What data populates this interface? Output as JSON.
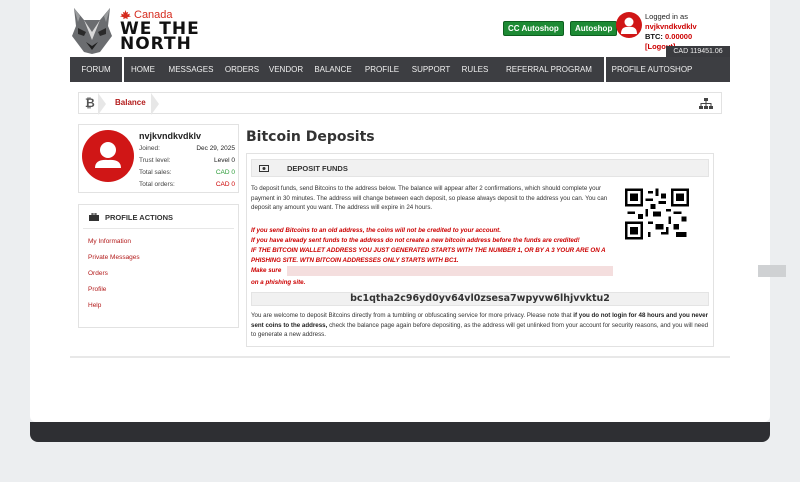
{
  "brand": {
    "country": "Canada",
    "line1": "WE THE",
    "line2": "NORTH"
  },
  "header": {
    "cc_autoshop": "CC Autoshop",
    "autoshop": "Autoshop",
    "logged_in_as": "Logged in as",
    "username": "nvjkvndkvdklv",
    "btc_label": "BTC:",
    "btc_value": "0.00000",
    "logout": "[Logout]",
    "cad_badge": "CAD 119451.06"
  },
  "nav": [
    {
      "label": "FORUM"
    },
    {
      "label": "HOME"
    },
    {
      "label": "MESSAGES"
    },
    {
      "label": "ORDERS"
    },
    {
      "label": "VENDOR"
    },
    {
      "label": "BALANCE"
    },
    {
      "label": "PROFILE"
    },
    {
      "label": "SUPPORT"
    },
    {
      "label": "RULES"
    },
    {
      "label": "REFERRAL PROGRAM"
    },
    {
      "label": "PROFILE AUTOSHOP"
    }
  ],
  "breadcrumb": {
    "current": "Balance"
  },
  "profile": {
    "username": "nvjkvndkvdklv",
    "joined_label": "Joined:",
    "joined": "Dec 29, 2025",
    "trust_label": "Trust level:",
    "trust": "Level 0",
    "sales_label": "Total sales:",
    "sales": "CAD 0",
    "orders_label": "Total orders:",
    "orders": "CAD 0"
  },
  "actions": {
    "title": "PROFILE ACTIONS",
    "links": [
      {
        "label": "My Information"
      },
      {
        "label": "Private Messages"
      },
      {
        "label": "Orders"
      },
      {
        "label": "Profile"
      },
      {
        "label": "Help"
      }
    ]
  },
  "page": {
    "title": "Bitcoin Deposits",
    "panel_title": "DEPOSIT FUNDS",
    "intro": "To deposit funds, send Bitcoins to the address below. The balance will appear after 2 confirmations, which should complete your payment in 30 minutes. The address will change between each deposit, so please always deposit to the address you can. You can deposit any amount you want. The address will expire in 24 hours.",
    "warn1": "If you send Bitcoins to an old address, the coins will not be credited to your account.",
    "warn2": "If you have already sent funds to the address do not create a new bitcoin address before the funds are credited!",
    "warn3": "IF THE BITCOIN WALLET ADDRESS YOU JUST GENERATED STARTS WITH THE NUMBER 1, OR BY A 3 YOUR ARE ON A PHISHING SITE. WTN BITCOIN ADDRESSES ONLY STARTS WITH BC1.",
    "warn4": "Make sure",
    "warn5": "on a phishing site.",
    "address": "bc1qtha2c96yd0yv64vl0zsesa7wpyvw6lhjvvktu2",
    "outro_a": "You are welcome to deposit Bitcoins directly from a tumbling or obfuscating service for more privacy. Please note that ",
    "outro_b": "if you do not login for 48 hours and you never sent coins to the address,",
    "outro_c": " check the balance page again before depositing, as the address will get unlinked from your account for security reasons, and you will need to generate a new address."
  },
  "colors": {
    "accent_red": "#c00000",
    "nav_bg": "#3d3e42",
    "button_green": "#1d8a34"
  }
}
